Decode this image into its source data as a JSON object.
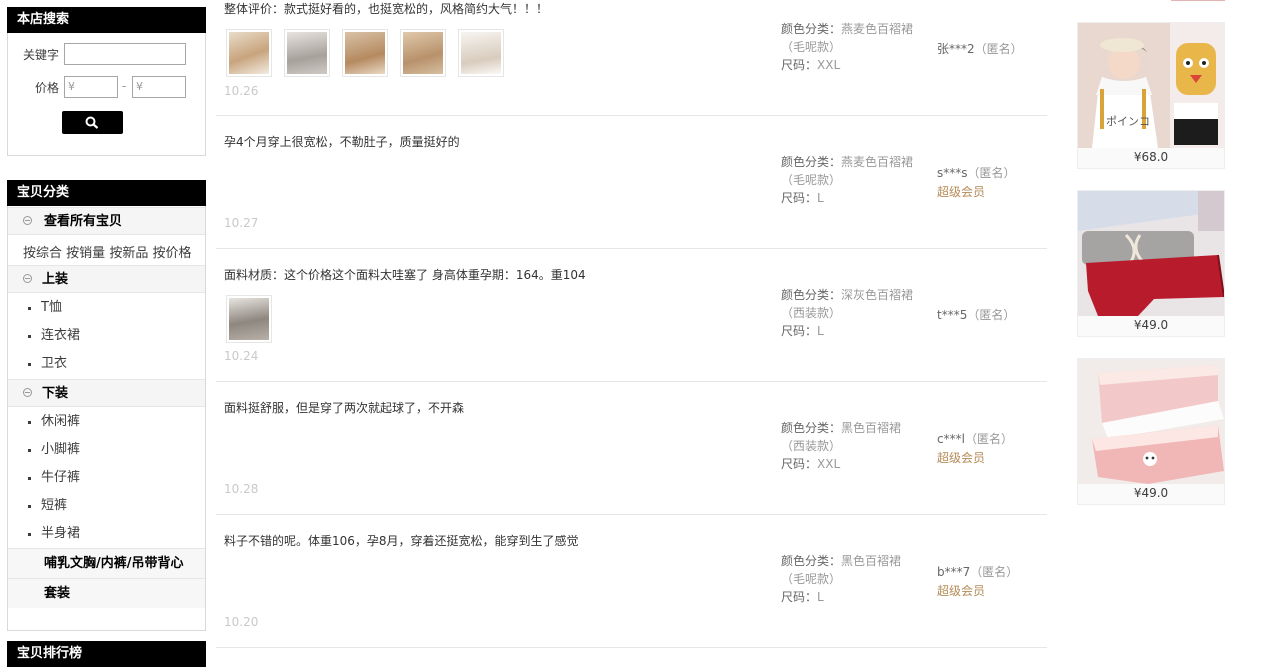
{
  "search": {
    "title": "本店搜索",
    "keyword_label": "关键字",
    "keyword_value": "",
    "price_label": "价格",
    "price_min_placeholder": "¥",
    "price_max_placeholder": "¥",
    "price_separator": "-",
    "button_icon": "search-icon"
  },
  "categories": {
    "title": "宝贝分类",
    "all_label": "查看所有宝贝",
    "sort_links": [
      "按综合",
      "按销量",
      "按新品",
      "按价格"
    ],
    "groups": [
      {
        "label": "上装",
        "items": [
          "T恤",
          "连衣裙",
          "卫衣"
        ]
      },
      {
        "label": "下装",
        "items": [
          "休闲裤",
          "小脚裤",
          "牛仔裤",
          "短裤",
          "半身裙"
        ]
      }
    ],
    "extra": [
      "哺乳文胸/内裤/吊带背心",
      "套装"
    ]
  },
  "ranking": {
    "title": "宝贝排行榜"
  },
  "reviews": [
    {
      "text": "整体评价：款式挺好看的，也挺宽松的，风格简约大气！！！",
      "date": "10.26",
      "color_label": "颜色分类：",
      "color_value": "燕麦色百褶裙（毛呢款）",
      "size_label": "尺码：",
      "size_value": "XXL",
      "user": "张***2",
      "anon": "（匿名）",
      "vip": "",
      "thumbs": 5
    },
    {
      "text": "孕4个月穿上很宽松，不勒肚子，质量挺好的",
      "date": "10.27",
      "color_label": "颜色分类：",
      "color_value": "燕麦色百褶裙（毛呢款）",
      "size_label": "尺码：",
      "size_value": "L",
      "user": "s***s",
      "anon": "（匿名）",
      "vip": "超级会员",
      "thumbs": 0
    },
    {
      "text": "面料材质：这个价格这个面料太哇塞了 身高体重孕期：164。重104",
      "date": "10.24",
      "color_label": "颜色分类：",
      "color_value": "深灰色百褶裙（西装款）",
      "size_label": "尺码：",
      "size_value": "L",
      "user": "t***5",
      "anon": "（匿名）",
      "vip": "",
      "thumbs": 1
    },
    {
      "text": "面料挺舒服，但是穿了两次就起球了，不开森",
      "date": "10.28",
      "color_label": "颜色分类：",
      "color_value": "黑色百褶裙（西装款）",
      "size_label": "尺码：",
      "size_value": "XXL",
      "user": "c***l",
      "anon": "（匿名）",
      "vip": "超级会员",
      "thumbs": 0
    },
    {
      "text": "料子不错的呢。体重106，孕8月，穿着还挺宽松，能穿到生了感觉",
      "date": "10.20",
      "color_label": "颜色分类：",
      "color_value": "黑色百褶裙（毛呢款）",
      "size_label": "尺码：",
      "size_value": "L",
      "user": "b***7",
      "anon": "（匿名）",
      "vip": "超级会员",
      "thumbs": 0
    }
  ],
  "products": [
    {
      "price": "¥68.0",
      "image": "maternity-tshirt-photo"
    },
    {
      "price": "¥49.0",
      "image": "maternity-shorts-photo"
    },
    {
      "price": "¥49.0",
      "image": "maternity-underwear-photo"
    }
  ],
  "colors": {
    "header_bg": "#000000",
    "vip": "#b58b59",
    "date": "#c9c9c9"
  }
}
